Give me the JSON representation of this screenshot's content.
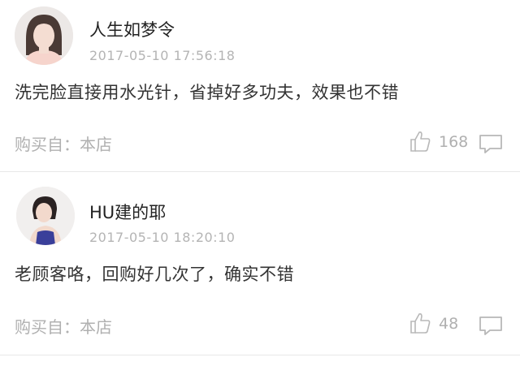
{
  "reviews": [
    {
      "username": "人生如梦令",
      "timestamp": "2017-05-10   17:56:18",
      "comment": "洗完脸直接用水光针，省掉好多功夫，效果也不错",
      "source": "购买自：本店",
      "likes": "168",
      "avatar_icon": "user-avatar-photo"
    },
    {
      "username": "HU建的耶",
      "timestamp": "2017-05-10   18:20:10",
      "comment": "老顾客咯，回购好几次了，确实不错",
      "source": "购买自：本店",
      "likes": "48",
      "avatar_icon": "user-avatar-photo"
    }
  ],
  "icons": {
    "like": "thumbs-up-icon",
    "reply": "comment-bubble-icon"
  },
  "colors": {
    "muted_text": "#b0b0b0",
    "primary_text": "#222222",
    "divider": "#e8e8e8"
  }
}
